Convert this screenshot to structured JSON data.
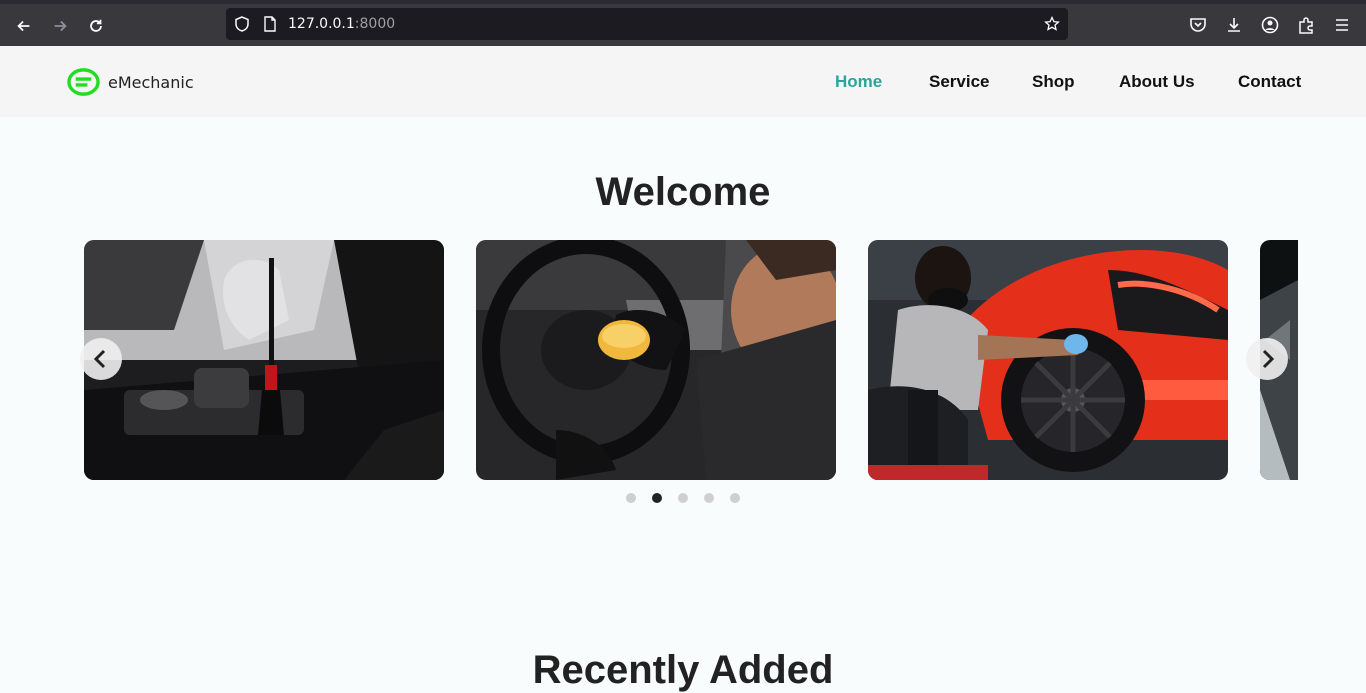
{
  "browser": {
    "url_host": "127.0.0.1",
    "url_port": ":8000"
  },
  "site": {
    "brand": "eMechanic",
    "brand_color": "#22dd22",
    "accent_color": "#2aa59b",
    "nav": {
      "home": "Home",
      "service": "Service",
      "shop": "Shop",
      "about": "About Us",
      "contact": "Contact"
    }
  },
  "main": {
    "welcome_title": "Welcome",
    "recent_title": "Recently Added",
    "carousel": {
      "active_dot": 2,
      "dot_count": 5
    }
  }
}
